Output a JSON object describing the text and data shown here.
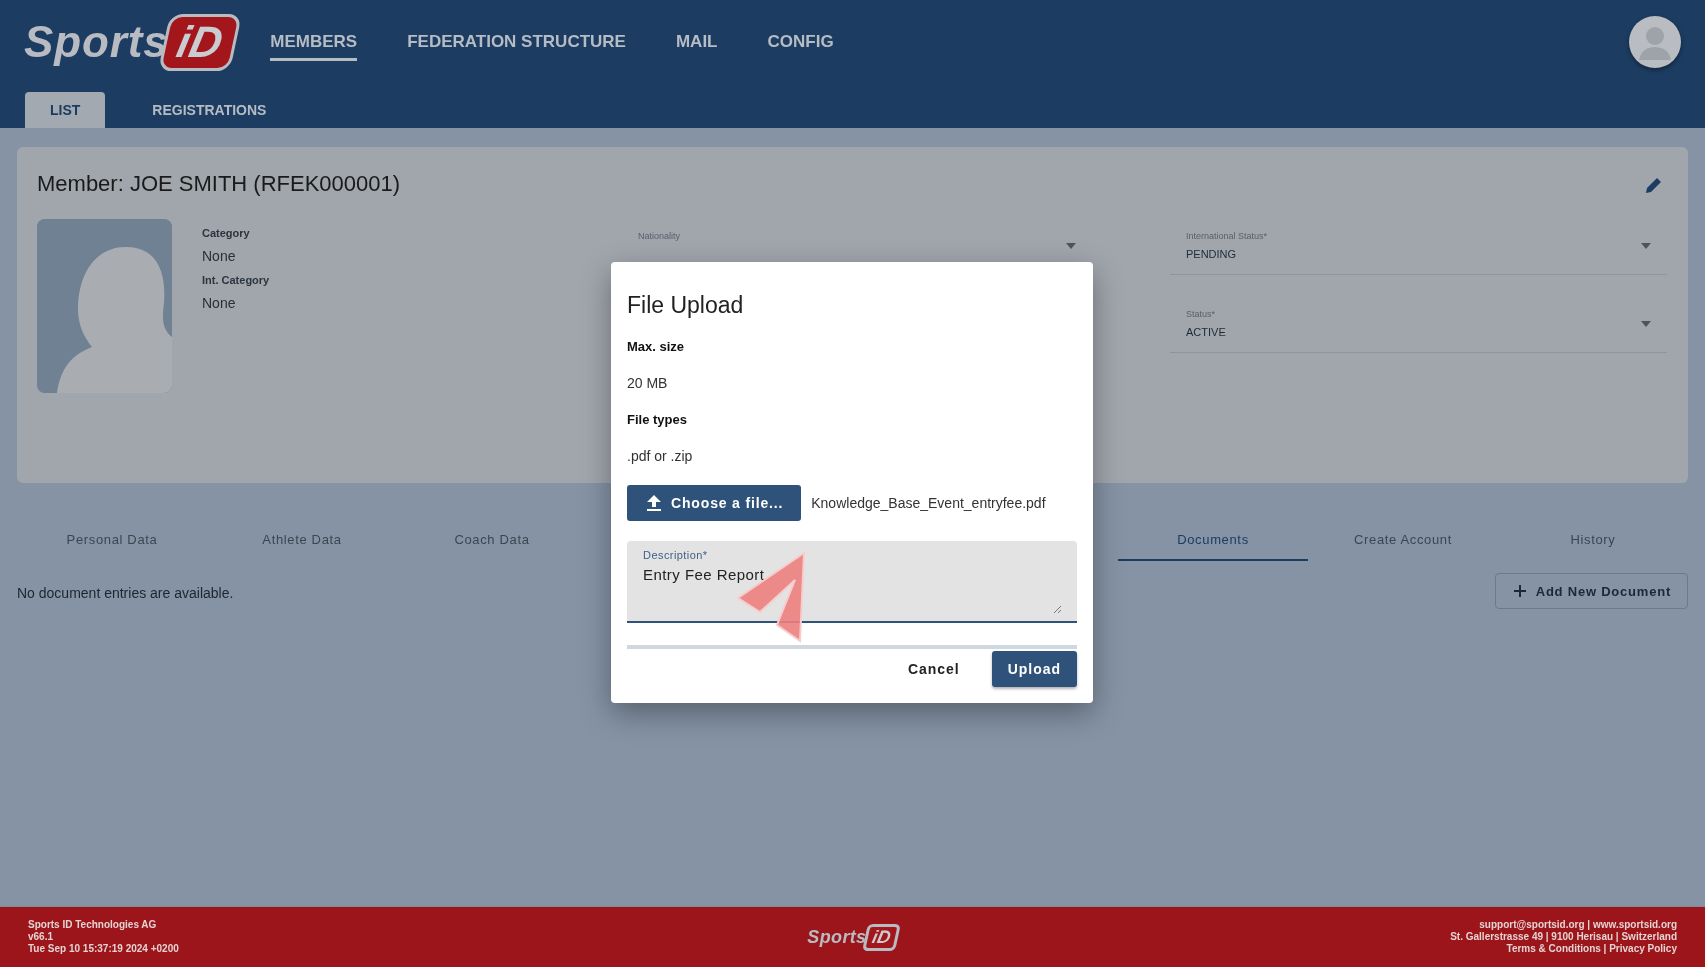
{
  "header": {
    "logo": {
      "text": "Sports",
      "badge": "iD"
    },
    "nav": [
      {
        "label": "MEMBERS",
        "selected": true
      },
      {
        "label": "FEDERATION STRUCTURE",
        "selected": false
      },
      {
        "label": "MAIL",
        "selected": false
      },
      {
        "label": "CONFIG",
        "selected": false
      }
    ],
    "subtabs": [
      {
        "label": "LIST",
        "selected": true
      },
      {
        "label": "REGISTRATIONS",
        "selected": false
      }
    ]
  },
  "member": {
    "title": "Member: JOE SMITH (RFEK000001)",
    "fields": [
      {
        "label": "Category",
        "value": "None"
      },
      {
        "label": "Int. Category",
        "value": "None"
      }
    ],
    "selects": [
      {
        "label": "Nationality"
      },
      {
        "label": "International Status*",
        "value": "PENDING"
      },
      {
        "label": "Status*",
        "value": "ACTIVE"
      }
    ]
  },
  "detail_tabs": [
    {
      "label": "Personal Data",
      "selected": false
    },
    {
      "label": "Athlete Data",
      "selected": false
    },
    {
      "label": "Coach Data",
      "selected": false
    },
    {
      "label": "Documents",
      "selected": true
    },
    {
      "label": "Create Account",
      "selected": false
    },
    {
      "label": "History",
      "selected": false
    }
  ],
  "documents": {
    "empty_message": "No document entries are available.",
    "add_button": "Add New Document"
  },
  "dialog": {
    "title": "File Upload",
    "max_size_label": "Max. size",
    "max_size": "20 MB",
    "file_types_label": "File types",
    "file_types": ".pdf or .zip",
    "choose_button": "Choose a file...",
    "file_name": "Knowledge_Base_Event_entryfee.pdf",
    "description": {
      "label": "Description*",
      "value": "Entry Fee Report"
    },
    "progress": {
      "level": 0
    },
    "buttons": [
      {
        "label": "Cancel",
        "kind": "text"
      },
      {
        "label": "Upload",
        "kind": "primary"
      }
    ]
  },
  "footer": {
    "logo": {
      "text": "Sports",
      "badge": "iD"
    },
    "left": [
      "Sports ID Technologies AG",
      "v66.1",
      "Tue Sep 10 15:37:19 2024 +0200"
    ],
    "right": [
      "support@sportsid.org | www.sportsid.org",
      "St. Gallerstrasse 49 | 9100 Herisau | Switzerland",
      "Terms & Conditions | Privacy Policy"
    ]
  }
}
